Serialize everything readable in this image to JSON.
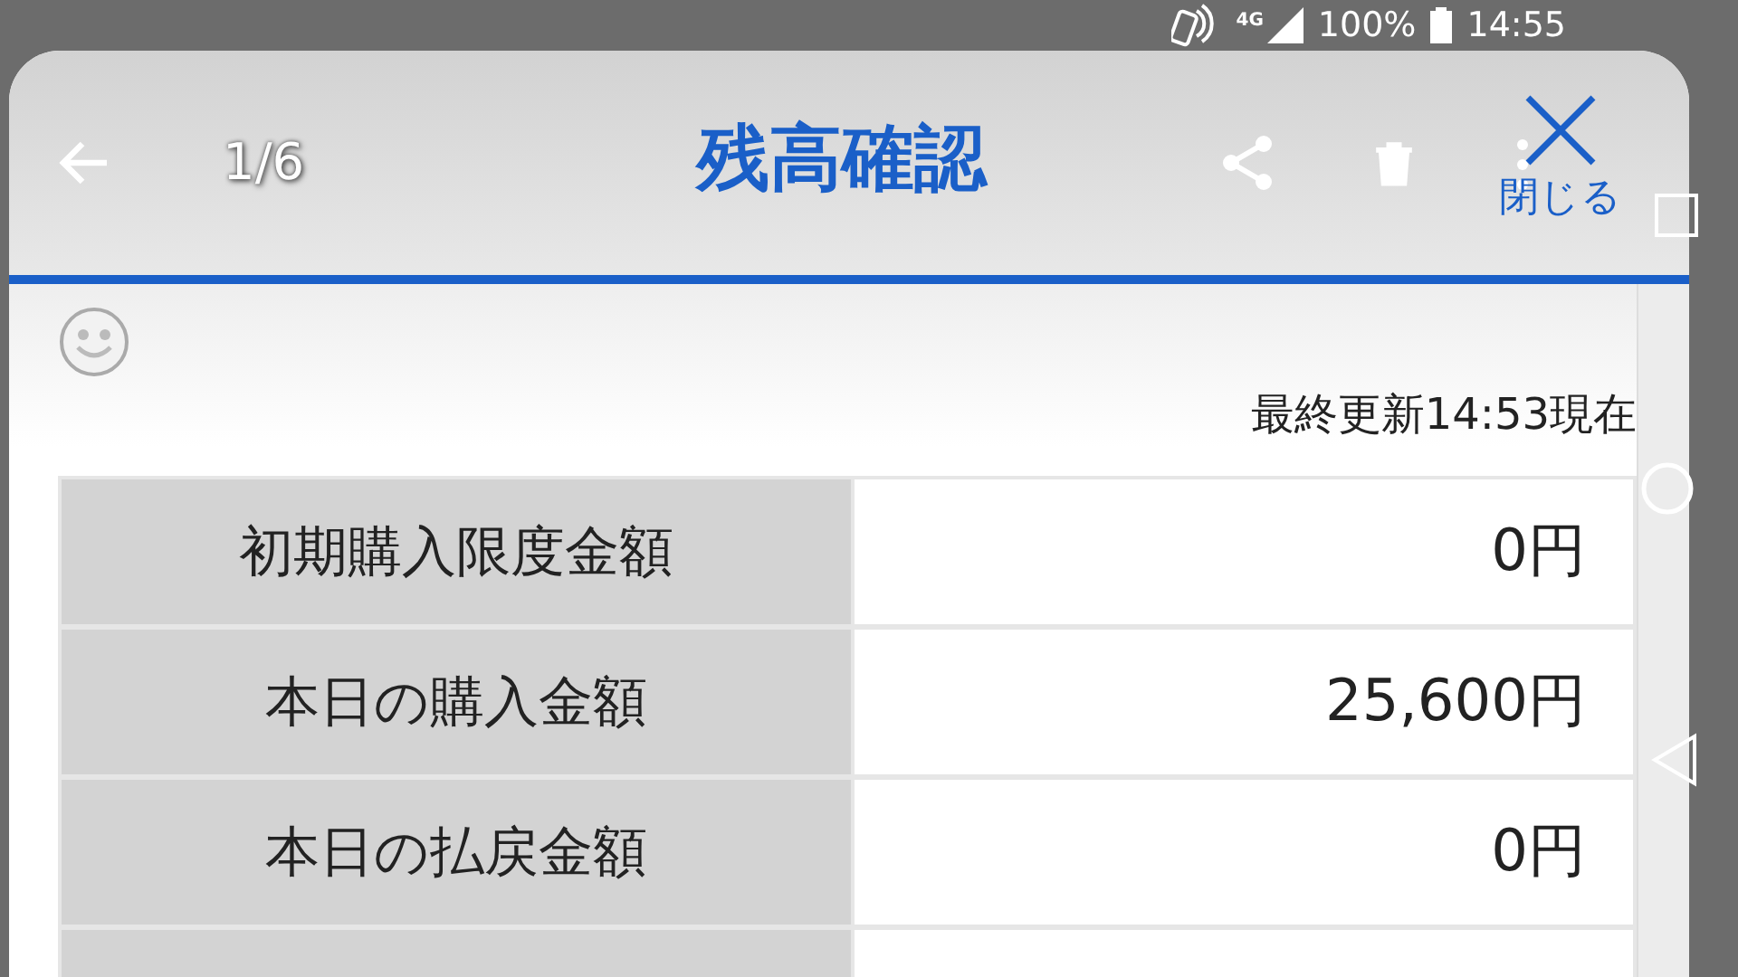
{
  "status_bar": {
    "network": "4G",
    "battery": "100%",
    "time": "14:55"
  },
  "dialog": {
    "page": "1/6",
    "title": "残高確認",
    "close_label": "閉じる",
    "updated": "最終更新14:53現在",
    "rows": [
      {
        "label": "初期購入限度金額",
        "value": "0円"
      },
      {
        "label": "本日の購入金額",
        "value": "25,600円"
      },
      {
        "label": "本日の払戻金額",
        "value": "0円"
      }
    ]
  }
}
